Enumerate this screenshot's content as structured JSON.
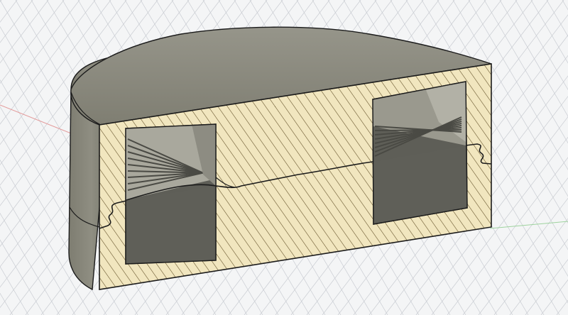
{
  "viewport": {
    "background": "#f4f5f6",
    "grid_color": "#c9ccd2",
    "axis_x_color": "#e39a9a",
    "axis_y_color": "#9ed39e"
  },
  "model": {
    "body_color": "#8f8e80",
    "body_dark_color": "#77766a",
    "top_color": "#8a8a7a",
    "section_color": "#f1e6bf",
    "hatch_color": "#5c4a22",
    "cavity_color": "#5e5e57",
    "cavity_light_color": "#a9a89d",
    "edge_color": "#1b1b1b"
  }
}
